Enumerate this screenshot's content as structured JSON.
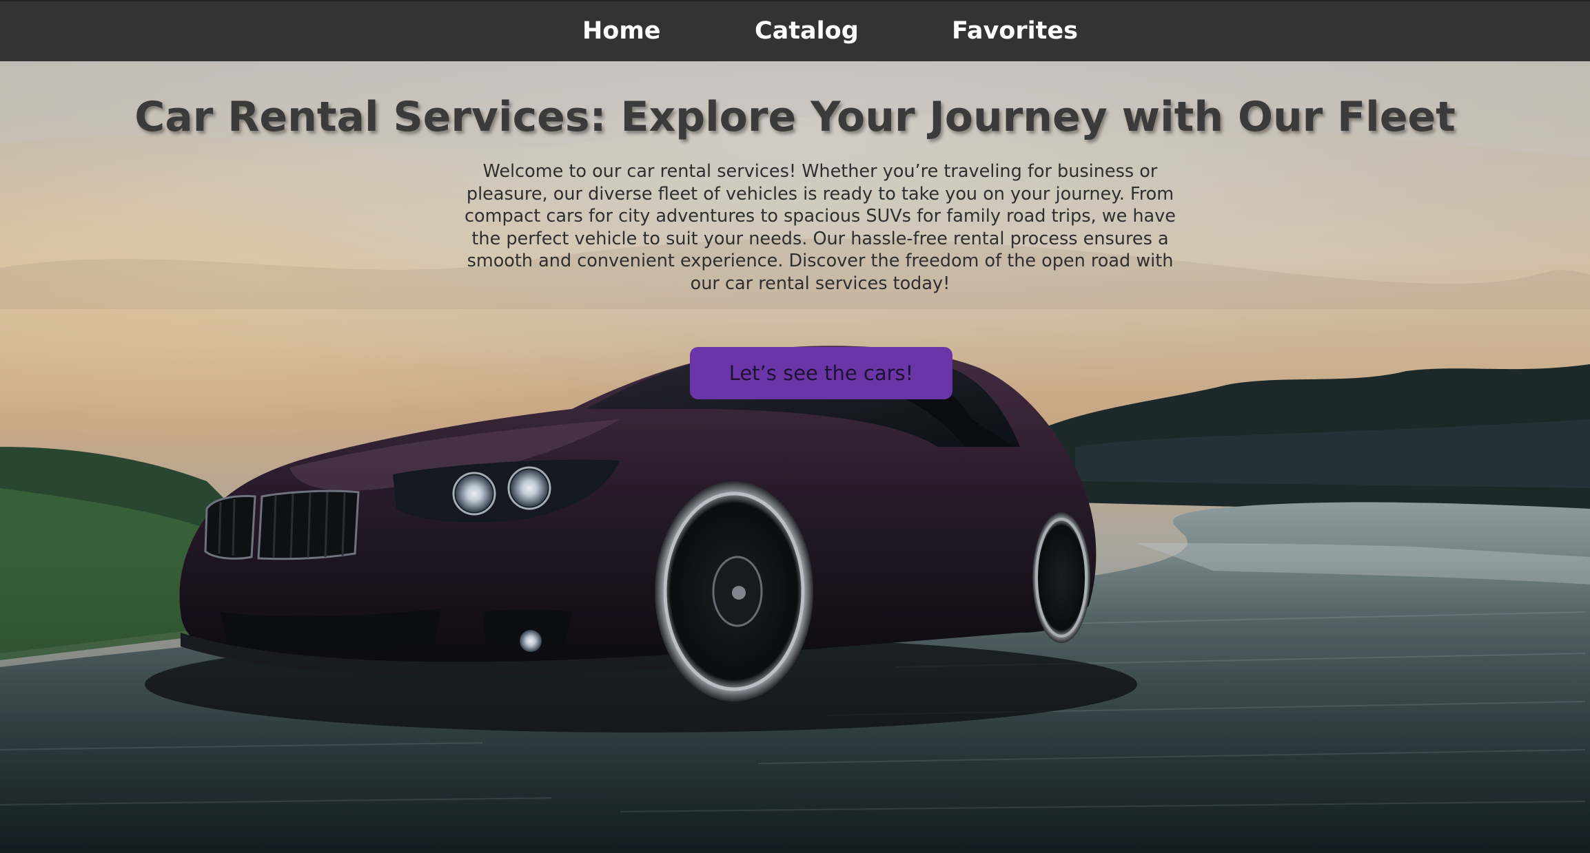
{
  "nav": {
    "items": [
      {
        "label": "Home"
      },
      {
        "label": "Catalog"
      },
      {
        "label": "Favorites"
      }
    ],
    "background_color": "#333333",
    "text_color": "#ffffff"
  },
  "hero": {
    "title": "Car Rental Services: Explore Your Journey with Our Fleet",
    "description": "Welcome to our car rental services! Whether you’re traveling for business or pleasure, our diverse fleet of vehicles is ready to take you on your journey. From compact cars for city adventures to spacious SUVs for family road trips, we have the perfect vehicle to suit your needs. Our hassle-free rental process ensures a smooth and convenient experience. Discover the freedom of the open road with our car rental services today!",
    "cta_label": "Let’s see the cars!",
    "cta_color": "#6a35a7",
    "background_image": "purple-sports-car-on-road"
  }
}
